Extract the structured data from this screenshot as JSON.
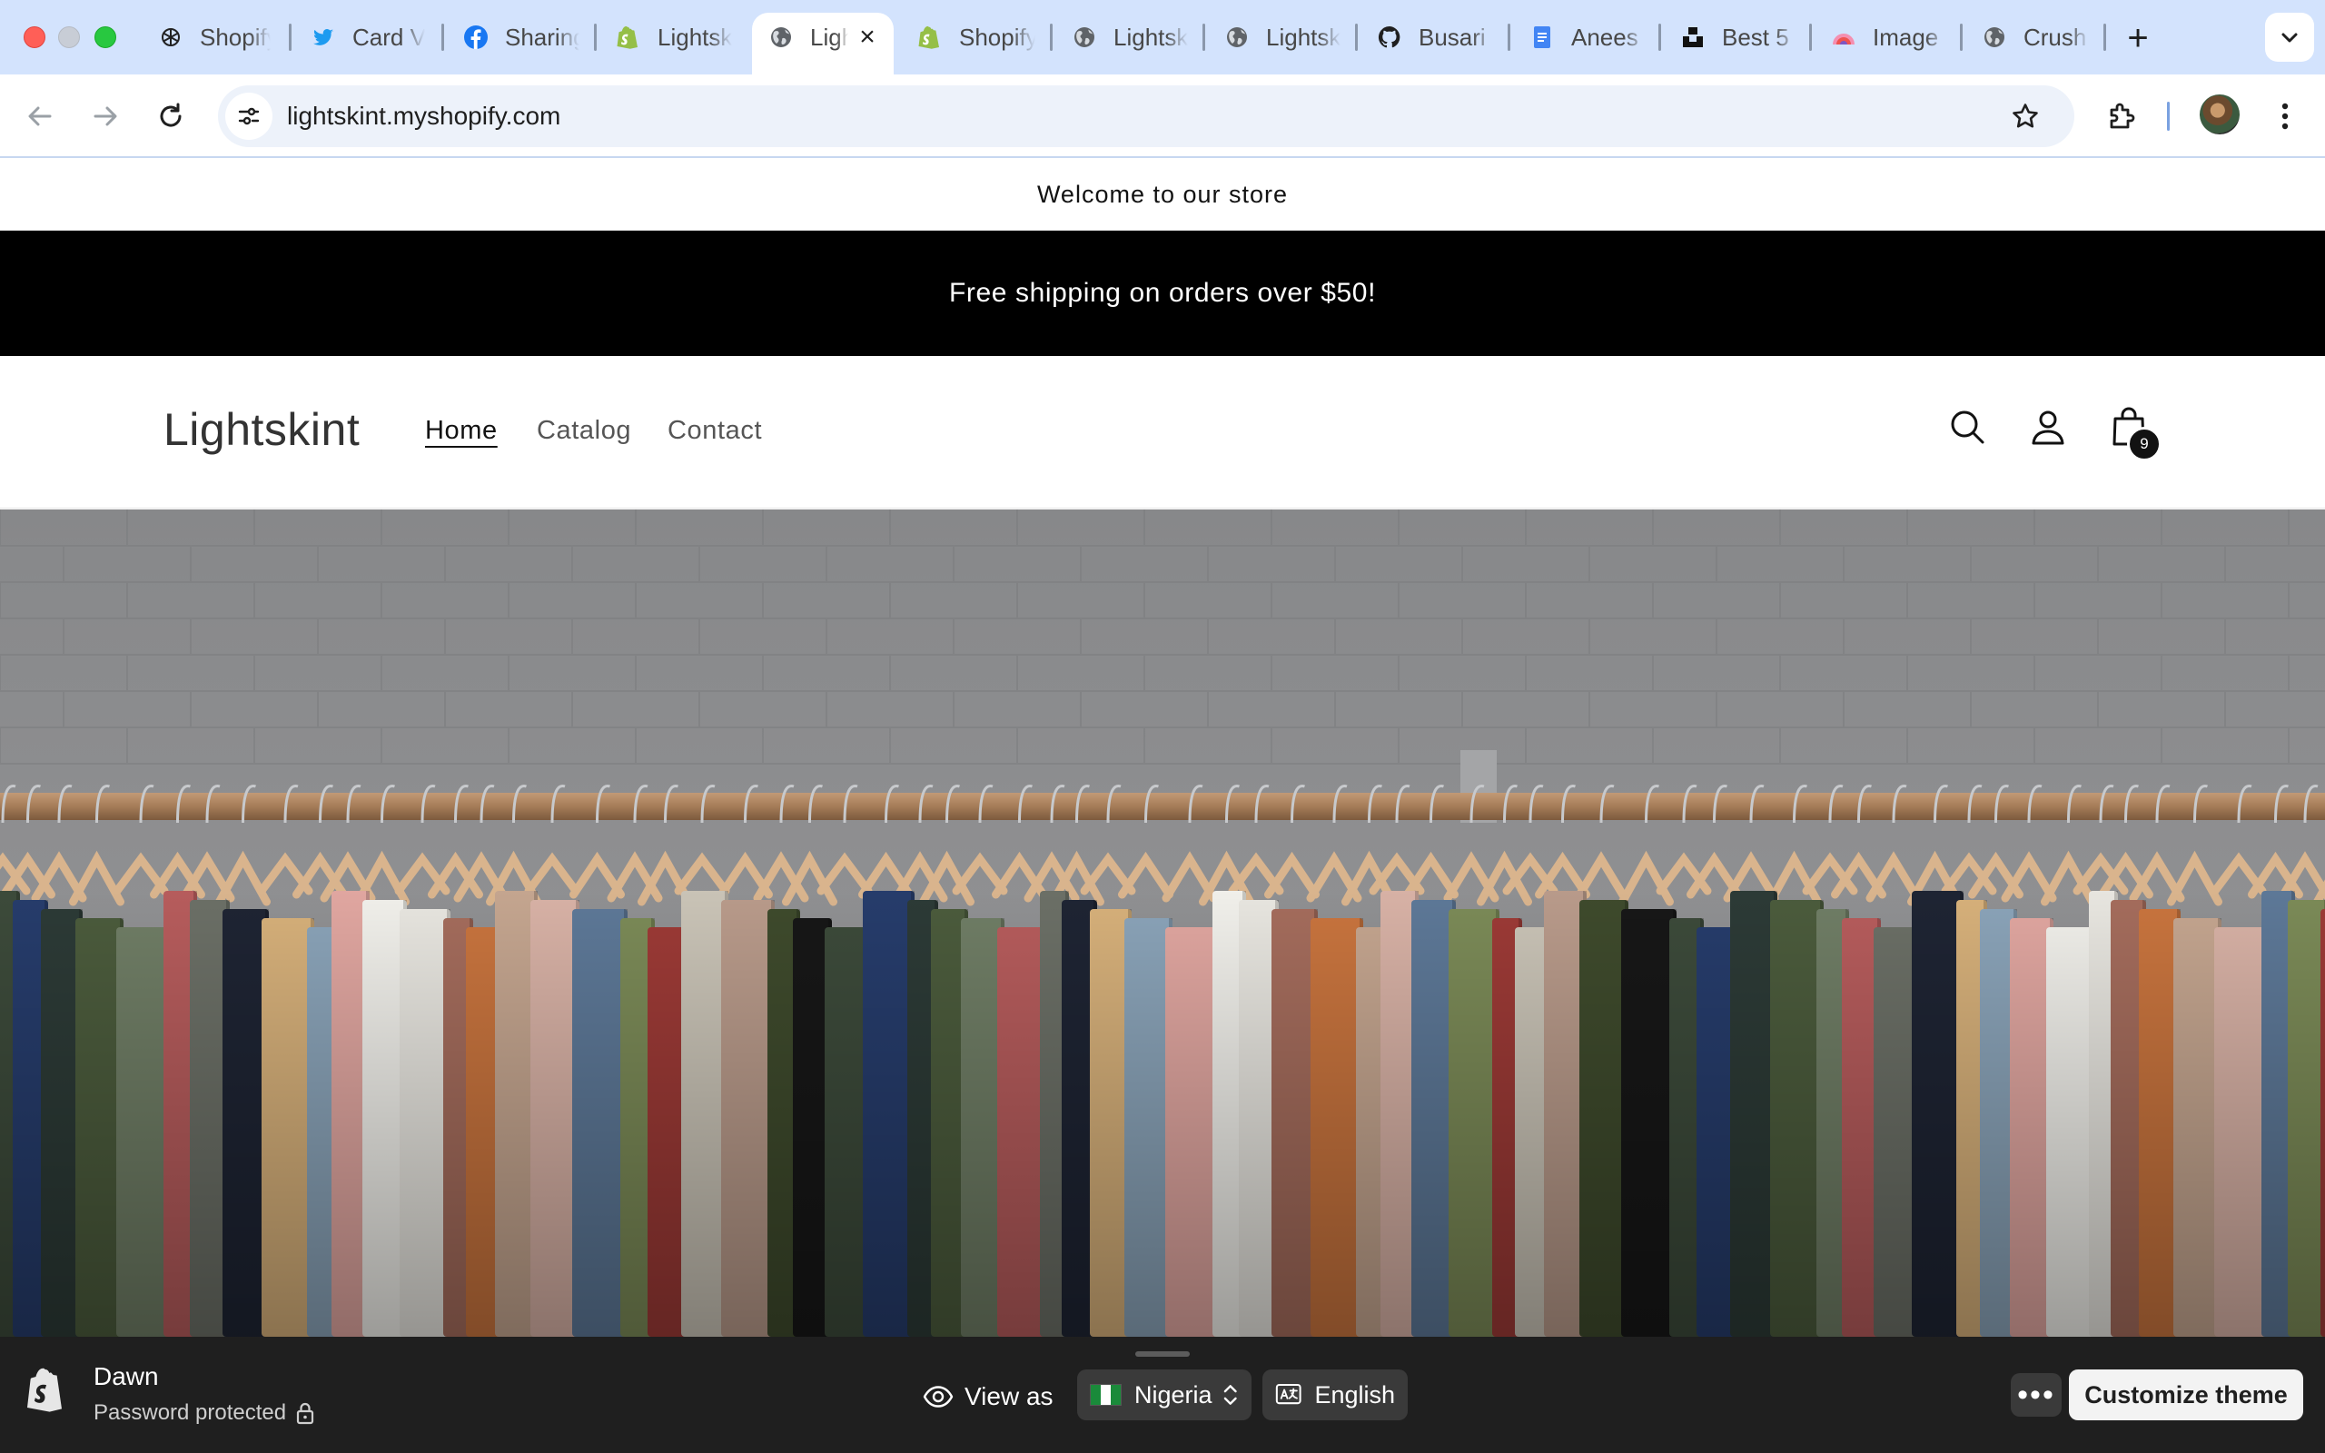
{
  "browser": {
    "tabs": [
      {
        "title": "Shopify",
        "icon": "openai-icon"
      },
      {
        "title": "Card V",
        "icon": "twitter-icon"
      },
      {
        "title": "Sharing",
        "icon": "facebook-icon"
      },
      {
        "title": "Lightskint",
        "icon": "shopify-icon"
      },
      {
        "title": "Lightskint",
        "icon": "globe-icon",
        "active": true
      },
      {
        "title": "Shopify",
        "icon": "shopify-icon"
      },
      {
        "title": "Lightskint",
        "icon": "globe-icon"
      },
      {
        "title": "Lightskint",
        "icon": "globe-icon"
      },
      {
        "title": "Busari",
        "icon": "github-icon"
      },
      {
        "title": "Anees",
        "icon": "docs-icon"
      },
      {
        "title": "Best 5",
        "icon": "unsplash-icon"
      },
      {
        "title": "Image",
        "icon": "image-icon"
      },
      {
        "title": "Crush",
        "icon": "globe-icon"
      }
    ],
    "url": "lightskint.myshopify.com"
  },
  "store": {
    "announcement": "Welcome to our store",
    "shipping_banner": "Free shipping on orders over $50!",
    "logo": "Lightskint",
    "nav": [
      "Home",
      "Catalog",
      "Contact"
    ],
    "active_nav": "Home",
    "cart_count": "9"
  },
  "preview_bar": {
    "theme_name": "Dawn",
    "status": "Password protected",
    "view_as_label": "View as",
    "country": "Nigeria",
    "language": "English",
    "more_label": "•••",
    "customize_label": "Customize theme"
  },
  "colors": {
    "tabstrip": "#d3e3fd",
    "shipping_bar": "#000000",
    "preview_bar": "#1f1f1f"
  }
}
